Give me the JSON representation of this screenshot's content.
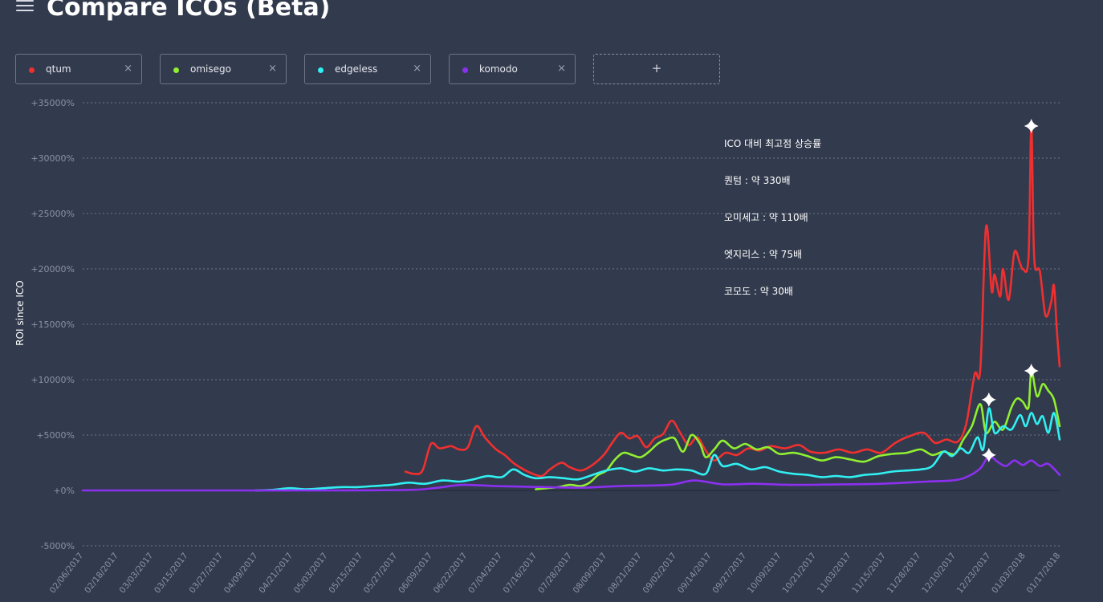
{
  "header": {
    "title": "Compare ICOs (Beta)",
    "menu_icon": "hamburger-menu-icon"
  },
  "tokens": [
    {
      "name": "qtum",
      "color": "#f03030",
      "close": "×"
    },
    {
      "name": "omisego",
      "color": "#90ef30",
      "close": "×"
    },
    {
      "name": "edgeless",
      "color": "#30f0f2",
      "close": "×"
    },
    {
      "name": "komodo",
      "color": "#8c30f0",
      "close": "×"
    }
  ],
  "add_button": {
    "label": "+"
  },
  "annotation": {
    "lines": [
      "ICO 대비 최고점 상승률",
      "퀀텀 : 약 330배",
      "오미세고 : 약 110배",
      "엣지리스 : 약 75배",
      "코모도 : 약 30배"
    ]
  },
  "chart_data": {
    "type": "line",
    "ylabel": "ROI since ICO",
    "ylim": [
      -5000,
      35000
    ],
    "yticks": [
      -5000,
      0,
      5000,
      10000,
      15000,
      20000,
      25000,
      30000,
      35000
    ],
    "ytick_labels": [
      "-5000%",
      "+0%",
      "+5000%",
      "+10000%",
      "+15000%",
      "+20000%",
      "+25000%",
      "+30000%",
      "+35000%"
    ],
    "x_range": [
      "02/06/2017",
      "01/17/2018"
    ],
    "xtick_labels": [
      "02/06/2017",
      "02/18/2017",
      "03/03/2017",
      "03/15/2017",
      "03/27/2017",
      "04/09/2017",
      "04/21/2017",
      "05/03/2017",
      "05/15/2017",
      "05/27/2017",
      "06/09/2017",
      "06/22/2017",
      "07/04/2017",
      "07/16/2017",
      "07/28/2017",
      "08/09/2017",
      "08/21/2017",
      "09/02/2017",
      "09/14/2017",
      "09/27/2017",
      "10/09/2017",
      "10/21/2017",
      "11/03/2017",
      "11/15/2017",
      "11/28/2017",
      "12/10/2017",
      "12/23/2017",
      "01/03/2018",
      "01/17/2018"
    ],
    "grid": true,
    "series": [
      {
        "name": "qtum",
        "color": "#f03030",
        "points": [
          [
            "05/31/2017",
            1700
          ],
          [
            "06/03/2017",
            1500
          ],
          [
            "06/06/2017",
            1800
          ],
          [
            "06/09/2017",
            4200
          ],
          [
            "06/12/2017",
            3800
          ],
          [
            "06/16/2017",
            4000
          ],
          [
            "06/19/2017",
            3700
          ],
          [
            "06/22/2017",
            3900
          ],
          [
            "06/25/2017",
            5800
          ],
          [
            "06/28/2017",
            4800
          ],
          [
            "07/02/2017",
            3700
          ],
          [
            "07/05/2017",
            3200
          ],
          [
            "07/08/2017",
            2500
          ],
          [
            "07/11/2017",
            2000
          ],
          [
            "07/14/2017",
            1600
          ],
          [
            "07/18/2017",
            1300
          ],
          [
            "07/21/2017",
            1900
          ],
          [
            "07/25/2017",
            2500
          ],
          [
            "07/28/2017",
            2100
          ],
          [
            "08/01/2017",
            1800
          ],
          [
            "08/05/2017",
            2300
          ],
          [
            "08/09/2017",
            3200
          ],
          [
            "08/12/2017",
            4300
          ],
          [
            "08/15/2017",
            5200
          ],
          [
            "08/18/2017",
            4700
          ],
          [
            "08/21/2017",
            4900
          ],
          [
            "08/24/2017",
            3900
          ],
          [
            "08/27/2017",
            4700
          ],
          [
            "08/30/2017",
            5100
          ],
          [
            "09/02/2017",
            6300
          ],
          [
            "09/05/2017",
            5200
          ],
          [
            "09/08/2017",
            4100
          ],
          [
            "09/11/2017",
            4800
          ],
          [
            "09/14/2017",
            3600
          ],
          [
            "09/17/2017",
            2700
          ],
          [
            "09/21/2017",
            3400
          ],
          [
            "09/25/2017",
            3200
          ],
          [
            "09/29/2017",
            3800
          ],
          [
            "10/03/2017",
            3600
          ],
          [
            "10/07/2017",
            4000
          ],
          [
            "10/12/2017",
            3800
          ],
          [
            "10/17/2017",
            4100
          ],
          [
            "10/21/2017",
            3500
          ],
          [
            "10/26/2017",
            3400
          ],
          [
            "10/31/2017",
            3700
          ],
          [
            "11/05/2017",
            3400
          ],
          [
            "11/10/2017",
            3700
          ],
          [
            "11/15/2017",
            3400
          ],
          [
            "11/20/2017",
            4300
          ],
          [
            "11/25/2017",
            4900
          ],
          [
            "11/30/2017",
            5200
          ],
          [
            "12/04/2017",
            4300
          ],
          [
            "12/08/2017",
            4600
          ],
          [
            "12/12/2017",
            4400
          ],
          [
            "12/15/2017",
            6000
          ],
          [
            "12/18/2017",
            10500
          ],
          [
            "12/20/2017",
            11000
          ],
          [
            "12/22/2017",
            23800
          ],
          [
            "12/24/2017",
            18000
          ],
          [
            "12/25/2017",
            19500
          ],
          [
            "12/27/2017",
            17500
          ],
          [
            "12/28/2017",
            20000
          ],
          [
            "12/30/2017",
            17200
          ],
          [
            "01/01/2018",
            21500
          ],
          [
            "01/03/2018",
            20500
          ],
          [
            "01/04/2018",
            20000
          ],
          [
            "01/06/2018",
            21000
          ],
          [
            "01/07/2018",
            32900
          ],
          [
            "01/08/2018",
            21000
          ],
          [
            "01/10/2018",
            19800
          ],
          [
            "01/12/2018",
            15800
          ],
          [
            "01/14/2018",
            17000
          ],
          [
            "01/15/2018",
            18500
          ],
          [
            "01/16/2018",
            14500
          ],
          [
            "01/17/2018",
            11200
          ]
        ]
      },
      {
        "name": "omisego",
        "color": "#90ef30",
        "points": [
          [
            "07/16/2017",
            100
          ],
          [
            "07/20/2017",
            200
          ],
          [
            "07/24/2017",
            300
          ],
          [
            "07/28/2017",
            500
          ],
          [
            "08/01/2017",
            400
          ],
          [
            "08/04/2017",
            700
          ],
          [
            "08/07/2017",
            1400
          ],
          [
            "08/10/2017",
            1800
          ],
          [
            "08/13/2017",
            2800
          ],
          [
            "08/16/2017",
            3400
          ],
          [
            "08/19/2017",
            3200
          ],
          [
            "08/22/2017",
            3000
          ],
          [
            "08/25/2017",
            3500
          ],
          [
            "08/28/2017",
            4200
          ],
          [
            "08/31/2017",
            4600
          ],
          [
            "09/03/2017",
            4700
          ],
          [
            "09/06/2017",
            3500
          ],
          [
            "09/09/2017",
            5000
          ],
          [
            "09/12/2017",
            4200
          ],
          [
            "09/14/2017",
            3000
          ],
          [
            "09/17/2017",
            3700
          ],
          [
            "09/20/2017",
            4500
          ],
          [
            "09/24/2017",
            3800
          ],
          [
            "09/28/2017",
            4200
          ],
          [
            "10/02/2017",
            3700
          ],
          [
            "10/06/2017",
            3900
          ],
          [
            "10/10/2017",
            3300
          ],
          [
            "10/15/2017",
            3400
          ],
          [
            "10/20/2017",
            3100
          ],
          [
            "10/25/2017",
            2700
          ],
          [
            "10/30/2017",
            3000
          ],
          [
            "11/04/2017",
            2800
          ],
          [
            "11/09/2017",
            2600
          ],
          [
            "11/14/2017",
            3100
          ],
          [
            "11/19/2017",
            3300
          ],
          [
            "11/24/2017",
            3400
          ],
          [
            "11/29/2017",
            3700
          ],
          [
            "12/03/2017",
            3200
          ],
          [
            "12/07/2017",
            3500
          ],
          [
            "12/11/2017",
            3300
          ],
          [
            "12/14/2017",
            4600
          ],
          [
            "12/17/2017",
            5800
          ],
          [
            "12/20/2017",
            7800
          ],
          [
            "12/22/2017",
            5200
          ],
          [
            "12/25/2017",
            6200
          ],
          [
            "12/28/2017",
            5500
          ],
          [
            "12/31/2017",
            7500
          ],
          [
            "01/02/2018",
            8300
          ],
          [
            "01/04/2018",
            8000
          ],
          [
            "01/06/2018",
            7500
          ],
          [
            "01/07/2018",
            10800
          ],
          [
            "01/09/2018",
            8500
          ],
          [
            "01/11/2018",
            9600
          ],
          [
            "01/13/2018",
            9000
          ],
          [
            "01/15/2018",
            8200
          ],
          [
            "01/17/2018",
            5800
          ]
        ]
      },
      {
        "name": "edgeless",
        "color": "#30f0f2",
        "points": [
          [
            "04/08/2017",
            0
          ],
          [
            "04/14/2017",
            50
          ],
          [
            "04/20/2017",
            200
          ],
          [
            "04/26/2017",
            100
          ],
          [
            "05/02/2017",
            200
          ],
          [
            "05/08/2017",
            300
          ],
          [
            "05/14/2017",
            300
          ],
          [
            "05/20/2017",
            400
          ],
          [
            "05/26/2017",
            500
          ],
          [
            "06/01/2017",
            700
          ],
          [
            "06/07/2017",
            600
          ],
          [
            "06/13/2017",
            900
          ],
          [
            "06/19/2017",
            800
          ],
          [
            "06/24/2017",
            1000
          ],
          [
            "06/29/2017",
            1300
          ],
          [
            "07/04/2017",
            1200
          ],
          [
            "07/08/2017",
            1900
          ],
          [
            "07/12/2017",
            1400
          ],
          [
            "07/16/2017",
            1100
          ],
          [
            "07/21/2017",
            1200
          ],
          [
            "07/26/2017",
            1100
          ],
          [
            "07/31/2017",
            1000
          ],
          [
            "08/05/2017",
            1400
          ],
          [
            "08/10/2017",
            1800
          ],
          [
            "08/15/2017",
            2000
          ],
          [
            "08/20/2017",
            1700
          ],
          [
            "08/25/2017",
            2000
          ],
          [
            "08/30/2017",
            1800
          ],
          [
            "09/04/2017",
            1900
          ],
          [
            "09/09/2017",
            1800
          ],
          [
            "09/14/2017",
            1500
          ],
          [
            "09/17/2017",
            3200
          ],
          [
            "09/20/2017",
            2200
          ],
          [
            "09/25/2017",
            2400
          ],
          [
            "09/30/2017",
            1900
          ],
          [
            "10/05/2017",
            2100
          ],
          [
            "10/10/2017",
            1700
          ],
          [
            "10/15/2017",
            1500
          ],
          [
            "10/20/2017",
            1400
          ],
          [
            "10/25/2017",
            1200
          ],
          [
            "10/30/2017",
            1300
          ],
          [
            "11/04/2017",
            1200
          ],
          [
            "11/09/2017",
            1400
          ],
          [
            "11/14/2017",
            1500
          ],
          [
            "11/19/2017",
            1700
          ],
          [
            "11/24/2017",
            1800
          ],
          [
            "11/29/2017",
            1900
          ],
          [
            "12/03/2017",
            2200
          ],
          [
            "12/07/2017",
            3500
          ],
          [
            "12/10/2017",
            3100
          ],
          [
            "12/13/2017",
            3800
          ],
          [
            "12/16/2017",
            3400
          ],
          [
            "12/19/2017",
            4800
          ],
          [
            "12/21/2017",
            3700
          ],
          [
            "12/23/2017",
            7400
          ],
          [
            "12/25/2017",
            5200
          ],
          [
            "12/28/2017",
            5800
          ],
          [
            "12/31/2017",
            5500
          ],
          [
            "01/03/2018",
            6800
          ],
          [
            "01/05/2018",
            5800
          ],
          [
            "01/07/2018",
            7000
          ],
          [
            "01/09/2018",
            6000
          ],
          [
            "01/11/2018",
            6700
          ],
          [
            "01/13/2018",
            5200
          ],
          [
            "01/15/2018",
            7000
          ],
          [
            "01/17/2018",
            4600
          ]
        ]
      },
      {
        "name": "komodo",
        "color": "#8c30f0",
        "points": [
          [
            "02/06/2017",
            0
          ],
          [
            "03/01/2017",
            0
          ],
          [
            "04/01/2017",
            0
          ],
          [
            "05/01/2017",
            0
          ],
          [
            "06/01/2017",
            50
          ],
          [
            "06/10/2017",
            200
          ],
          [
            "06/20/2017",
            500
          ],
          [
            "07/01/2017",
            400
          ],
          [
            "07/10/2017",
            350
          ],
          [
            "07/20/2017",
            300
          ],
          [
            "08/01/2017",
            250
          ],
          [
            "08/15/2017",
            400
          ],
          [
            "09/01/2017",
            500
          ],
          [
            "09/10/2017",
            900
          ],
          [
            "09/20/2017",
            550
          ],
          [
            "10/01/2017",
            600
          ],
          [
            "10/15/2017",
            500
          ],
          [
            "11/01/2017",
            550
          ],
          [
            "11/15/2017",
            600
          ],
          [
            "12/01/2017",
            800
          ],
          [
            "12/10/2017",
            900
          ],
          [
            "12/15/2017",
            1200
          ],
          [
            "12/20/2017",
            2000
          ],
          [
            "12/23/2017",
            3100
          ],
          [
            "12/26/2017",
            2600
          ],
          [
            "12/29/2017",
            2200
          ],
          [
            "01/01/2018",
            2700
          ],
          [
            "01/04/2018",
            2300
          ],
          [
            "01/07/2018",
            2700
          ],
          [
            "01/10/2018",
            2200
          ],
          [
            "01/13/2018",
            2400
          ],
          [
            "01/17/2018",
            1400
          ]
        ]
      }
    ],
    "peak_markers": [
      {
        "series": "qtum",
        "x": "01/07/2018",
        "y": 32900
      },
      {
        "series": "omisego",
        "x": "01/07/2018",
        "y": 10800
      },
      {
        "series": "edgeless",
        "x": "12/23/2017",
        "y": 8200
      },
      {
        "series": "komodo",
        "x": "12/23/2017",
        "y": 3200
      }
    ]
  }
}
